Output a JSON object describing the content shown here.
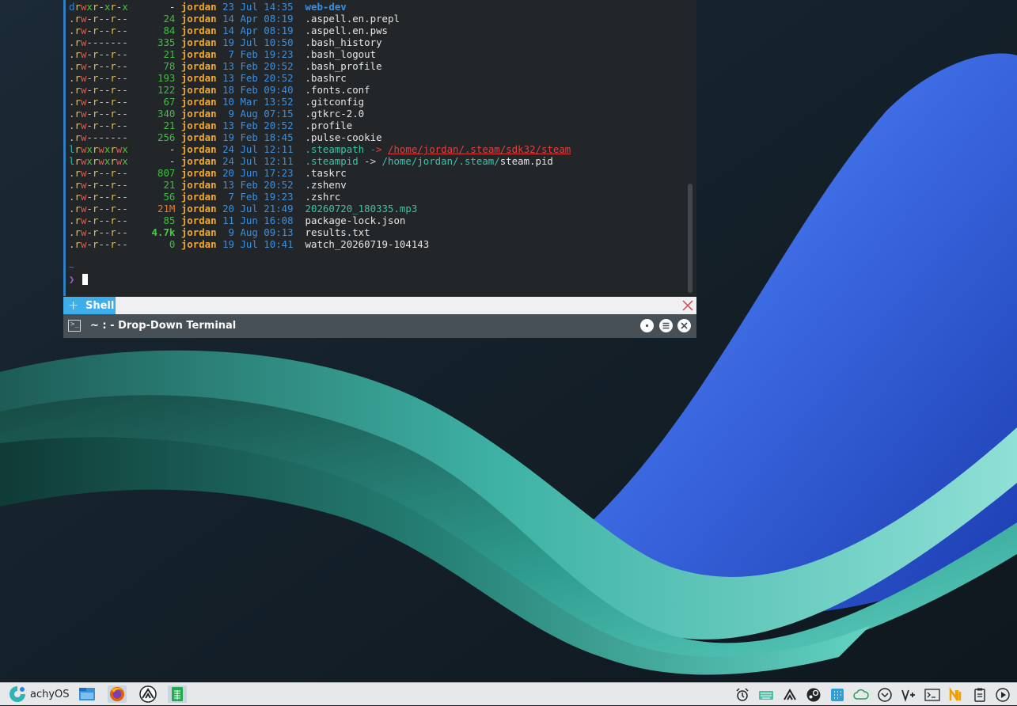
{
  "terminal": {
    "rows": [
      {
        "perm": [
          [
            "d",
            "c-d"
          ],
          [
            "r",
            "c-r"
          ],
          [
            "w",
            "c-w"
          ],
          [
            "x",
            "c-x"
          ],
          [
            "r",
            "c-r"
          ],
          [
            "-",
            "c-dash"
          ],
          [
            "x",
            "c-x"
          ],
          [
            "r",
            "c-r"
          ],
          [
            "-",
            "c-dash"
          ],
          [
            "x",
            "c-x"
          ]
        ],
        "size": "-",
        "size_class": "c-dash2",
        "user": "jordan",
        "date": "23 Jul 14:35",
        "icon": "",
        "name": "web-dev",
        "name_class": "c-dir"
      },
      {
        "perm": [
          [
            ".",
            "c-dash"
          ],
          [
            "r",
            "c-r"
          ],
          [
            "w",
            "c-w"
          ],
          [
            "-",
            "c-dash"
          ],
          [
            "r",
            "c-r"
          ],
          [
            "-",
            "c-dash"
          ],
          [
            "-",
            "c-dash"
          ],
          [
            "r",
            "c-r"
          ],
          [
            "-",
            "c-dash"
          ],
          [
            "-",
            "c-dash"
          ]
        ],
        "size": "24",
        "size_class": "c-size",
        "user": "jordan",
        "date": "14 Apr 08:19",
        "icon": "",
        "name": ".aspell.en.prepl",
        "name_class": ""
      },
      {
        "perm": [
          [
            ".",
            "c-dash"
          ],
          [
            "r",
            "c-r"
          ],
          [
            "w",
            "c-w"
          ],
          [
            "-",
            "c-dash"
          ],
          [
            "r",
            "c-r"
          ],
          [
            "-",
            "c-dash"
          ],
          [
            "-",
            "c-dash"
          ],
          [
            "r",
            "c-r"
          ],
          [
            "-",
            "c-dash"
          ],
          [
            "-",
            "c-dash"
          ]
        ],
        "size": "84",
        "size_class": "c-size",
        "user": "jordan",
        "date": "14 Apr 08:19",
        "icon": "",
        "name": ".aspell.en.pws",
        "name_class": ""
      },
      {
        "perm": [
          [
            ".",
            "c-dash"
          ],
          [
            "r",
            "c-r"
          ],
          [
            "w",
            "c-w"
          ],
          [
            "-",
            "c-dash"
          ],
          [
            "-",
            "c-dash"
          ],
          [
            "-",
            "c-dash"
          ],
          [
            "-",
            "c-dash"
          ],
          [
            "-",
            "c-dash"
          ],
          [
            "-",
            "c-dash"
          ],
          [
            "-",
            "c-dash"
          ]
        ],
        "size": "335",
        "size_class": "c-size",
        "user": "jordan",
        "date": "19 Jul 10:50",
        "icon": "",
        "name": ".bash_history",
        "name_class": ""
      },
      {
        "perm": [
          [
            ".",
            "c-dash"
          ],
          [
            "r",
            "c-r"
          ],
          [
            "w",
            "c-w"
          ],
          [
            "-",
            "c-dash"
          ],
          [
            "r",
            "c-r"
          ],
          [
            "-",
            "c-dash"
          ],
          [
            "-",
            "c-dash"
          ],
          [
            "r",
            "c-r"
          ],
          [
            "-",
            "c-dash"
          ],
          [
            "-",
            "c-dash"
          ]
        ],
        "size": "21",
        "size_class": "c-size",
        "user": "jordan",
        "date": " 7 Feb 19:23",
        "icon": "",
        "name": ".bash_logout",
        "name_class": ""
      },
      {
        "perm": [
          [
            ".",
            "c-dash"
          ],
          [
            "r",
            "c-r"
          ],
          [
            "w",
            "c-w"
          ],
          [
            "-",
            "c-dash"
          ],
          [
            "r",
            "c-r"
          ],
          [
            "-",
            "c-dash"
          ],
          [
            "-",
            "c-dash"
          ],
          [
            "r",
            "c-r"
          ],
          [
            "-",
            "c-dash"
          ],
          [
            "-",
            "c-dash"
          ]
        ],
        "size": "78",
        "size_class": "c-size",
        "user": "jordan",
        "date": "13 Feb 20:52",
        "icon": "",
        "name": ".bash_profile",
        "name_class": ""
      },
      {
        "perm": [
          [
            ".",
            "c-dash"
          ],
          [
            "r",
            "c-r"
          ],
          [
            "w",
            "c-w"
          ],
          [
            "-",
            "c-dash"
          ],
          [
            "r",
            "c-r"
          ],
          [
            "-",
            "c-dash"
          ],
          [
            "-",
            "c-dash"
          ],
          [
            "r",
            "c-r"
          ],
          [
            "-",
            "c-dash"
          ],
          [
            "-",
            "c-dash"
          ]
        ],
        "size": "193",
        "size_class": "c-size",
        "user": "jordan",
        "date": "13 Feb 20:52",
        "icon": "",
        "name": ".bashrc",
        "name_class": ""
      },
      {
        "perm": [
          [
            ".",
            "c-dash"
          ],
          [
            "r",
            "c-r"
          ],
          [
            "w",
            "c-w"
          ],
          [
            "-",
            "c-dash"
          ],
          [
            "r",
            "c-r"
          ],
          [
            "-",
            "c-dash"
          ],
          [
            "-",
            "c-dash"
          ],
          [
            "r",
            "c-r"
          ],
          [
            "-",
            "c-dash"
          ],
          [
            "-",
            "c-dash"
          ]
        ],
        "size": "122",
        "size_class": "c-size",
        "user": "jordan",
        "date": "18 Feb 09:40",
        "icon": "",
        "name": ".fonts.conf",
        "name_class": ""
      },
      {
        "perm": [
          [
            ".",
            "c-dash"
          ],
          [
            "r",
            "c-r"
          ],
          [
            "w",
            "c-w"
          ],
          [
            "-",
            "c-dash"
          ],
          [
            "r",
            "c-r"
          ],
          [
            "-",
            "c-dash"
          ],
          [
            "-",
            "c-dash"
          ],
          [
            "r",
            "c-r"
          ],
          [
            "-",
            "c-dash"
          ],
          [
            "-",
            "c-dash"
          ]
        ],
        "size": "67",
        "size_class": "c-size",
        "user": "jordan",
        "date": "10 Mar 13:52",
        "icon": "",
        "name": ".gitconfig",
        "name_class": ""
      },
      {
        "perm": [
          [
            ".",
            "c-dash"
          ],
          [
            "r",
            "c-r"
          ],
          [
            "w",
            "c-w"
          ],
          [
            "-",
            "c-dash"
          ],
          [
            "r",
            "c-r"
          ],
          [
            "-",
            "c-dash"
          ],
          [
            "-",
            "c-dash"
          ],
          [
            "r",
            "c-r"
          ],
          [
            "-",
            "c-dash"
          ],
          [
            "-",
            "c-dash"
          ]
        ],
        "size": "340",
        "size_class": "c-size",
        "user": "jordan",
        "date": " 9 Aug 07:15",
        "icon": "",
        "name": ".gtkrc-2.0",
        "name_class": ""
      },
      {
        "perm": [
          [
            ".",
            "c-dash"
          ],
          [
            "r",
            "c-r"
          ],
          [
            "w",
            "c-w"
          ],
          [
            "-",
            "c-dash"
          ],
          [
            "r",
            "c-r"
          ],
          [
            "-",
            "c-dash"
          ],
          [
            "-",
            "c-dash"
          ],
          [
            "r",
            "c-r"
          ],
          [
            "-",
            "c-dash"
          ],
          [
            "-",
            "c-dash"
          ]
        ],
        "size": "21",
        "size_class": "c-size",
        "user": "jordan",
        "date": "13 Feb 20:52",
        "icon": "",
        "name": ".profile",
        "name_class": ""
      },
      {
        "perm": [
          [
            ".",
            "c-dash"
          ],
          [
            "r",
            "c-r"
          ],
          [
            "w",
            "c-w"
          ],
          [
            "-",
            "c-dash"
          ],
          [
            "-",
            "c-dash"
          ],
          [
            "-",
            "c-dash"
          ],
          [
            "-",
            "c-dash"
          ],
          [
            "-",
            "c-dash"
          ],
          [
            "-",
            "c-dash"
          ],
          [
            "-",
            "c-dash"
          ]
        ],
        "size": "256",
        "size_class": "c-size",
        "user": "jordan",
        "date": "19 Feb 18:45",
        "icon": "",
        "name": ".pulse-cookie",
        "name_class": ""
      },
      {
        "perm": [
          [
            "l",
            "c-l"
          ],
          [
            "r",
            "c-r"
          ],
          [
            "w",
            "c-w"
          ],
          [
            "x",
            "c-x"
          ],
          [
            "r",
            "c-r"
          ],
          [
            "w",
            "c-w"
          ],
          [
            "x",
            "c-x"
          ],
          [
            "r",
            "c-r"
          ],
          [
            "w",
            "c-w"
          ],
          [
            "x",
            "c-x"
          ]
        ],
        "size": "-",
        "size_class": "c-dash2",
        "user": "jordan",
        "date": "24 Jul 12:11",
        "icon": "",
        "name": ".steampath",
        "name_class": "c-link",
        "arrow": " -> ",
        "arrow_class": "c-arrow-red",
        "target": "/home/jordan/.steam/sdk32/steam",
        "target_class": "c-target-red",
        "target_tail": ""
      },
      {
        "perm": [
          [
            "l",
            "c-l"
          ],
          [
            "r",
            "c-r"
          ],
          [
            "w",
            "c-w"
          ],
          [
            "x",
            "c-x"
          ],
          [
            "r",
            "c-r"
          ],
          [
            "w",
            "c-w"
          ],
          [
            "x",
            "c-x"
          ],
          [
            "r",
            "c-r"
          ],
          [
            "w",
            "c-w"
          ],
          [
            "x",
            "c-x"
          ]
        ],
        "size": "-",
        "size_class": "c-dash2",
        "user": "jordan",
        "date": "24 Jul 12:11",
        "icon": "",
        "name": ".steampid",
        "name_class": "c-link",
        "arrow": " -> ",
        "arrow_class": "c-arrow",
        "target": "/home/jordan/.steam/",
        "target_class": "c-target",
        "target_tail": "steam.pid"
      },
      {
        "perm": [
          [
            ".",
            "c-dash"
          ],
          [
            "r",
            "c-r"
          ],
          [
            "w",
            "c-w"
          ],
          [
            "-",
            "c-dash"
          ],
          [
            "r",
            "c-r"
          ],
          [
            "-",
            "c-dash"
          ],
          [
            "-",
            "c-dash"
          ],
          [
            "r",
            "c-r"
          ],
          [
            "-",
            "c-dash"
          ],
          [
            "-",
            "c-dash"
          ]
        ],
        "size": "807",
        "size_class": "c-size",
        "user": "jordan",
        "date": "20 Jun 17:23",
        "icon": "",
        "name": ".taskrc",
        "name_class": ""
      },
      {
        "perm": [
          [
            ".",
            "c-dash"
          ],
          [
            "r",
            "c-r"
          ],
          [
            "w",
            "c-w"
          ],
          [
            "-",
            "c-dash"
          ],
          [
            "r",
            "c-r"
          ],
          [
            "-",
            "c-dash"
          ],
          [
            "-",
            "c-dash"
          ],
          [
            "r",
            "c-r"
          ],
          [
            "-",
            "c-dash"
          ],
          [
            "-",
            "c-dash"
          ]
        ],
        "size": "21",
        "size_class": "c-size",
        "user": "jordan",
        "date": "13 Feb 20:52",
        "icon": "",
        "name": ".zshenv",
        "name_class": ""
      },
      {
        "perm": [
          [
            ".",
            "c-dash"
          ],
          [
            "r",
            "c-r"
          ],
          [
            "w",
            "c-w"
          ],
          [
            "-",
            "c-dash"
          ],
          [
            "r",
            "c-r"
          ],
          [
            "-",
            "c-dash"
          ],
          [
            "-",
            "c-dash"
          ],
          [
            "r",
            "c-r"
          ],
          [
            "-",
            "c-dash"
          ],
          [
            "-",
            "c-dash"
          ]
        ],
        "size": "56",
        "size_class": "c-size",
        "user": "jordan",
        "date": " 7 Feb 19:23",
        "icon": "",
        "name": ".zshrc",
        "name_class": ""
      },
      {
        "perm": [
          [
            ".",
            "c-dash"
          ],
          [
            "r",
            "c-r"
          ],
          [
            "w",
            "c-w"
          ],
          [
            "-",
            "c-dash"
          ],
          [
            "r",
            "c-r"
          ],
          [
            "-",
            "c-dash"
          ],
          [
            "-",
            "c-dash"
          ],
          [
            "r",
            "c-r"
          ],
          [
            "-",
            "c-dash"
          ],
          [
            "-",
            "c-dash"
          ]
        ],
        "size": "21M",
        "size_class": "c-sizeM",
        "user": "jordan",
        "date": "20 Jul 21:49",
        "icon": "",
        "name": "20260720_180335.mp3",
        "name_class": "c-audio"
      },
      {
        "perm": [
          [
            ".",
            "c-dash"
          ],
          [
            "r",
            "c-r"
          ],
          [
            "w",
            "c-w"
          ],
          [
            "-",
            "c-dash"
          ],
          [
            "r",
            "c-r"
          ],
          [
            "-",
            "c-dash"
          ],
          [
            "-",
            "c-dash"
          ],
          [
            "r",
            "c-r"
          ],
          [
            "-",
            "c-dash"
          ],
          [
            "-",
            "c-dash"
          ]
        ],
        "size": "85",
        "size_class": "c-size",
        "user": "jordan",
        "date": "11 Jun 16:08",
        "icon": "",
        "name": "package-lock.json",
        "name_class": ""
      },
      {
        "perm": [
          [
            ".",
            "c-dash"
          ],
          [
            "r",
            "c-r"
          ],
          [
            "w",
            "c-w"
          ],
          [
            "-",
            "c-dash"
          ],
          [
            "r",
            "c-r"
          ],
          [
            "-",
            "c-dash"
          ],
          [
            "-",
            "c-dash"
          ],
          [
            "r",
            "c-r"
          ],
          [
            "-",
            "c-dash"
          ],
          [
            "-",
            "c-dash"
          ]
        ],
        "size": "4.7k",
        "size_class": "c-sizeb",
        "user": "jordan",
        "date": " 9 Aug 09:13",
        "icon": "",
        "name": "results.txt",
        "name_class": ""
      },
      {
        "perm": [
          [
            ".",
            "c-dash"
          ],
          [
            "r",
            "c-r"
          ],
          [
            "w",
            "c-w"
          ],
          [
            "-",
            "c-dash"
          ],
          [
            "r",
            "c-r"
          ],
          [
            "-",
            "c-dash"
          ],
          [
            "-",
            "c-dash"
          ],
          [
            "r",
            "c-r"
          ],
          [
            "-",
            "c-dash"
          ],
          [
            "-",
            "c-dash"
          ]
        ],
        "size": "0",
        "size_class": "c-size",
        "user": "jordan",
        "date": "19 Jul 10:41",
        "icon": "",
        "name": "watch_20260719-104143",
        "name_class": ""
      }
    ],
    "prompt_dir": "~",
    "prompt_symbol": "❯"
  },
  "tabbar": {
    "tab_label": "Shell"
  },
  "window": {
    "title": "~ : - Drop-Down Terminal",
    "title_icon": "terminal-icon"
  },
  "taskbar": {
    "launcher_label": "achyOS",
    "tasks": [
      "file-manager-icon",
      "firefox-icon",
      "kdeconnect-icon",
      "spreadsheet-icon"
    ],
    "tray": [
      "alarm-icon",
      "keyboard-icon",
      "kdeconnect-tray-icon",
      "steam-icon",
      "app-grid-icon",
      "cloud-sync-icon",
      "mail-bell-icon",
      "vpn-icon",
      "terminal-tray-icon",
      "notes-icon",
      "clipboard-icon",
      "media-play-icon"
    ]
  },
  "colors": {
    "terminal_bg": "#232629",
    "tab_active": "#3daee9",
    "titlebar": "#475057",
    "taskbar": "#e6e8ea"
  }
}
